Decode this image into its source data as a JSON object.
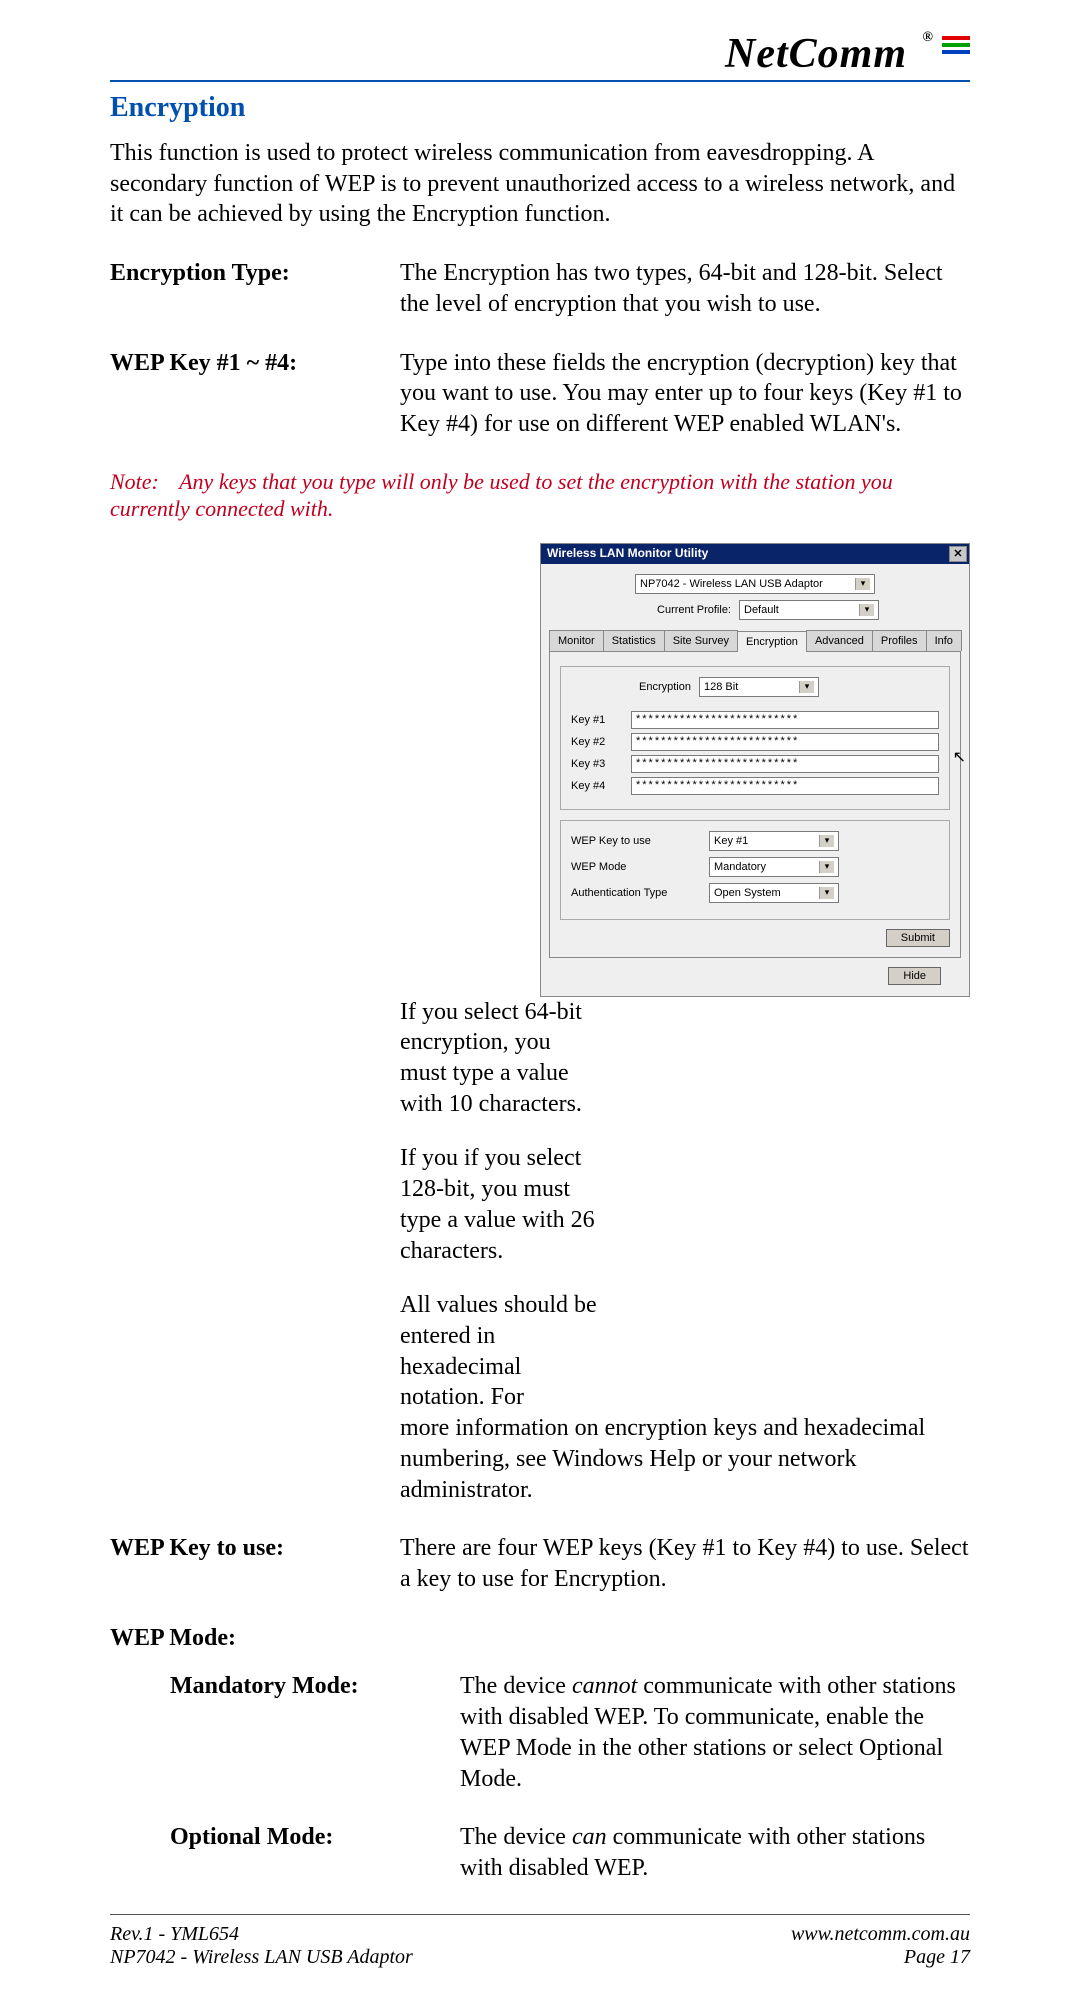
{
  "brand": "NetComm",
  "section_title": "Encryption",
  "intro": "This function is used to protect wireless communication from eavesdropping. A secondary function of WEP is to prevent unauthorized access to a wireless network, and it can be achieved by using the Encryption function.",
  "defs": {
    "encryption_type_label": "Encryption Type:",
    "encryption_type_text": "The Encryption has two types, 64-bit and 128-bit.  Select the level of encryption that you wish to use.",
    "wep_keys_label": "WEP Key #1 ~ #4:",
    "wep_keys_text": "Type into these fields the encryption (decryption) key that you want to use. You may enter up to four keys (Key #1 to Key #4) for use on different WEP enabled WLAN's."
  },
  "note_label": "Note:",
  "note_text": "Any keys that you type will only be used to set the encryption with the station you currently connected with.",
  "side_paras": {
    "p1": "If you select 64-bit encryption, you must type a value with 10 characters.",
    "p2": "If you if you select 128-bit, you must type a value with 26 characters.",
    "p3_a": "All values should be entered in hexadecimal notation. For",
    "p3_b": "more information on encryption keys and hexadecimal numbering, see Windows Help or your network administrator."
  },
  "defs2": {
    "wep_key_use_label": "WEP Key to use:",
    "wep_key_use_text": "There are four WEP keys (Key #1 to Key #4) to use.  Select a key to use for Encryption.",
    "wep_mode_label": "WEP Mode:",
    "mandatory_label": "Mandatory Mode:",
    "mandatory_pre": "The device ",
    "mandatory_em": "cannot",
    "mandatory_post": " communicate with other stations with disabled WEP.  To communicate, enable the WEP Mode in the other stations or select Optional Mode.",
    "optional_label": "Optional Mode:",
    "optional_pre": "The device ",
    "optional_em": "can",
    "optional_post": " communicate with other stations with disabled WEP."
  },
  "dialog": {
    "title": "Wireless LAN Monitor Utility",
    "adapter": "NP7042 - Wireless LAN USB Adaptor",
    "current_profile_label": "Current Profile:",
    "current_profile": "Default",
    "tabs": [
      "Monitor",
      "Statistics",
      "Site Survey",
      "Encryption",
      "Advanced",
      "Profiles",
      "Info"
    ],
    "encryption_label": "Encryption",
    "encryption_value": "128 Bit",
    "keys": {
      "k1_label": "Key #1",
      "k1": "**************************",
      "k2_label": "Key #2",
      "k2": "**************************",
      "k3_label": "Key #3",
      "k3": "**************************",
      "k4_label": "Key #4",
      "k4": "**************************"
    },
    "wep_key_use_label": "WEP Key to use",
    "wep_key_use": "Key #1",
    "wep_mode_label": "WEP Mode",
    "wep_mode": "Mandatory",
    "auth_label": "Authentication Type",
    "auth": "Open System",
    "submit": "Submit",
    "hide": "Hide"
  },
  "footer": {
    "left1": "Rev.1 - YML654",
    "left2": "NP7042 - Wireless LAN USB Adaptor",
    "right1": "www.netcomm.com.au",
    "right2": "Page 17"
  }
}
